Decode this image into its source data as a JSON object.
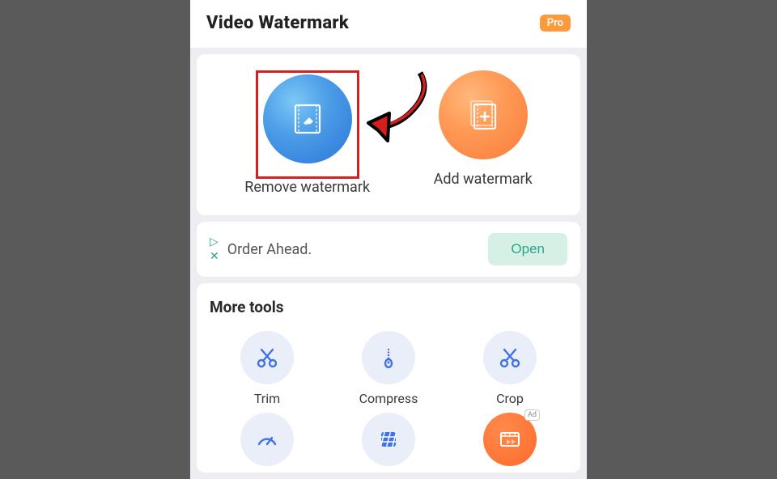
{
  "header": {
    "title": "Video Watermark",
    "pro_label": "Pro"
  },
  "features": {
    "remove": "Remove watermark",
    "add": "Add watermark"
  },
  "ad": {
    "text": "Order Ahead.",
    "button": "Open"
  },
  "more_tools": {
    "title": "More tools",
    "items": {
      "trim": "Trim",
      "compress": "Compress",
      "crop": "Crop"
    },
    "ad_badge": "Ad"
  }
}
